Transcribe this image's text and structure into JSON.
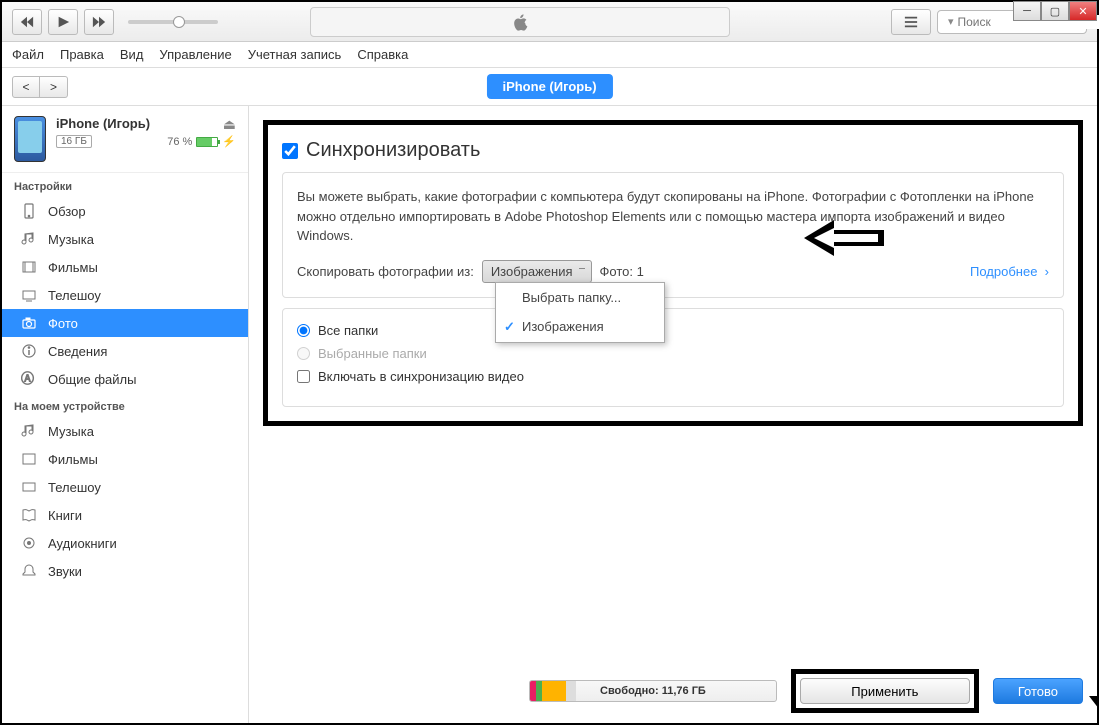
{
  "toolbar": {
    "search_placeholder": "Поиск"
  },
  "menubar": [
    "Файл",
    "Правка",
    "Вид",
    "Управление",
    "Учетная запись",
    "Справка"
  ],
  "device_pill": "iPhone (Игорь)",
  "device_header": {
    "name": "iPhone (Игорь)",
    "storage_badge": "16 ГБ",
    "battery_pct": "76 %"
  },
  "sidebar": {
    "section_settings": "Настройки",
    "items_settings": [
      {
        "label": "Обзор"
      },
      {
        "label": "Музыка"
      },
      {
        "label": "Фильмы"
      },
      {
        "label": "Телешоу"
      },
      {
        "label": "Фото"
      },
      {
        "label": "Сведения"
      },
      {
        "label": "Общие файлы"
      }
    ],
    "section_on_device": "На моем устройстве",
    "items_on_device": [
      {
        "label": "Музыка"
      },
      {
        "label": "Фильмы"
      },
      {
        "label": "Телешоу"
      },
      {
        "label": "Книги"
      },
      {
        "label": "Аудиокниги"
      },
      {
        "label": "Звуки"
      }
    ]
  },
  "sync": {
    "title": "Синхронизировать",
    "desc": "Вы можете выбрать, какие фотографии с компьютера будут скопированы на iPhone. Фотографии с Фотопленки на iPhone можно отдельно импортировать в Adobe Photoshop Elements или с помощью мастера импорта изображений и видео Windows.",
    "copy_label": "Скопировать фотографии из:",
    "select_value": "Изображения",
    "photo_count": "Фото: 1",
    "more": "Подробнее",
    "dropdown": [
      "Выбрать папку...",
      "Изображения"
    ],
    "radio_all": "Все папки",
    "radio_selected": "Выбранные папки",
    "include_video": "Включать в синхронизацию видео"
  },
  "footer": {
    "free": "Свободно: 11,76 ГБ",
    "apply": "Применить",
    "done": "Готово"
  }
}
